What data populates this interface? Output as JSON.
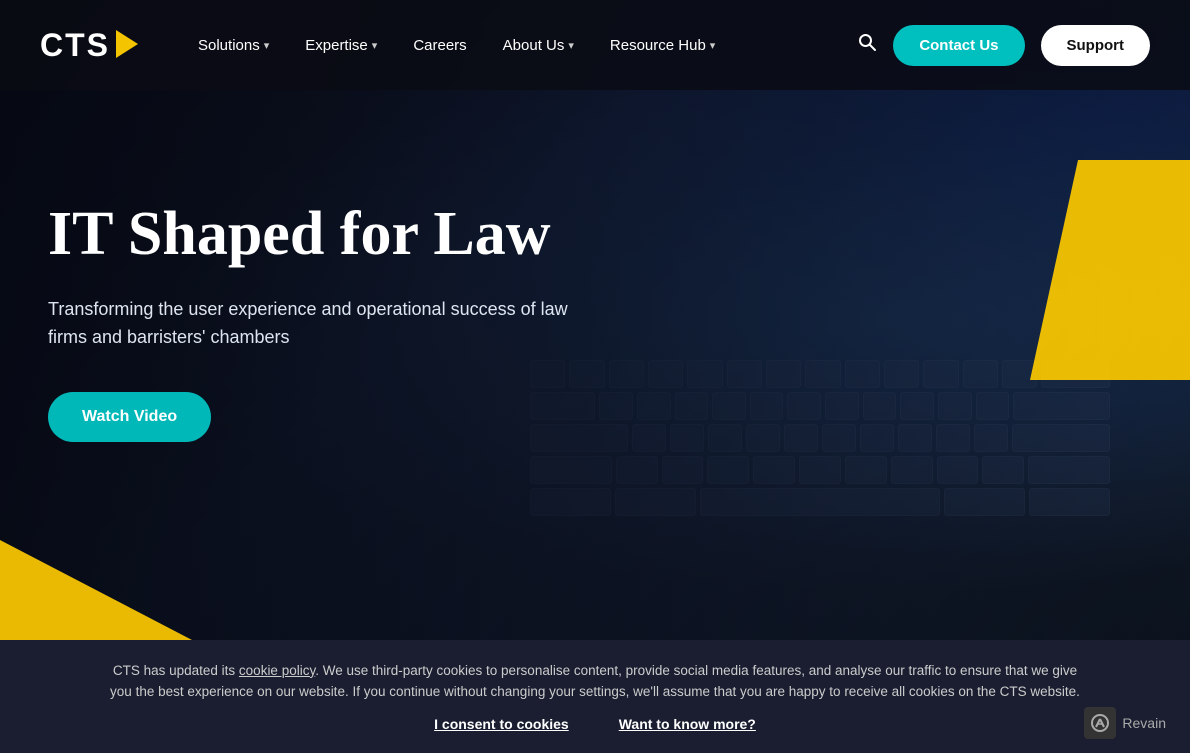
{
  "logo": {
    "text": "CTS"
  },
  "nav": {
    "links": [
      {
        "label": "Solutions",
        "hasDropdown": true
      },
      {
        "label": "Expertise",
        "hasDropdown": true
      },
      {
        "label": "Careers",
        "hasDropdown": false
      },
      {
        "label": "About Us",
        "hasDropdown": true
      },
      {
        "label": "Resource Hub",
        "hasDropdown": true
      }
    ],
    "contact_label": "Contact Us",
    "support_label": "Support"
  },
  "hero": {
    "title": "IT Shaped for Law",
    "subtitle": "Transforming the user experience and operational success of law firms and barristers' chambers",
    "cta_label": "Watch Video"
  },
  "cookie": {
    "message_prefix": "CTS has updated its ",
    "cookie_policy_link": "cookie policy",
    "message_body": ". We use third-party cookies to personalise content, provide social media features, and analyse our traffic to ensure that we give you the best experience on our website. If you continue without changing your settings, we'll assume that you are happy to receive all cookies on the CTS website.",
    "consent_label": "I consent to cookies",
    "know_more_label": "Want to know more?"
  },
  "revain": {
    "label": "Revain"
  }
}
